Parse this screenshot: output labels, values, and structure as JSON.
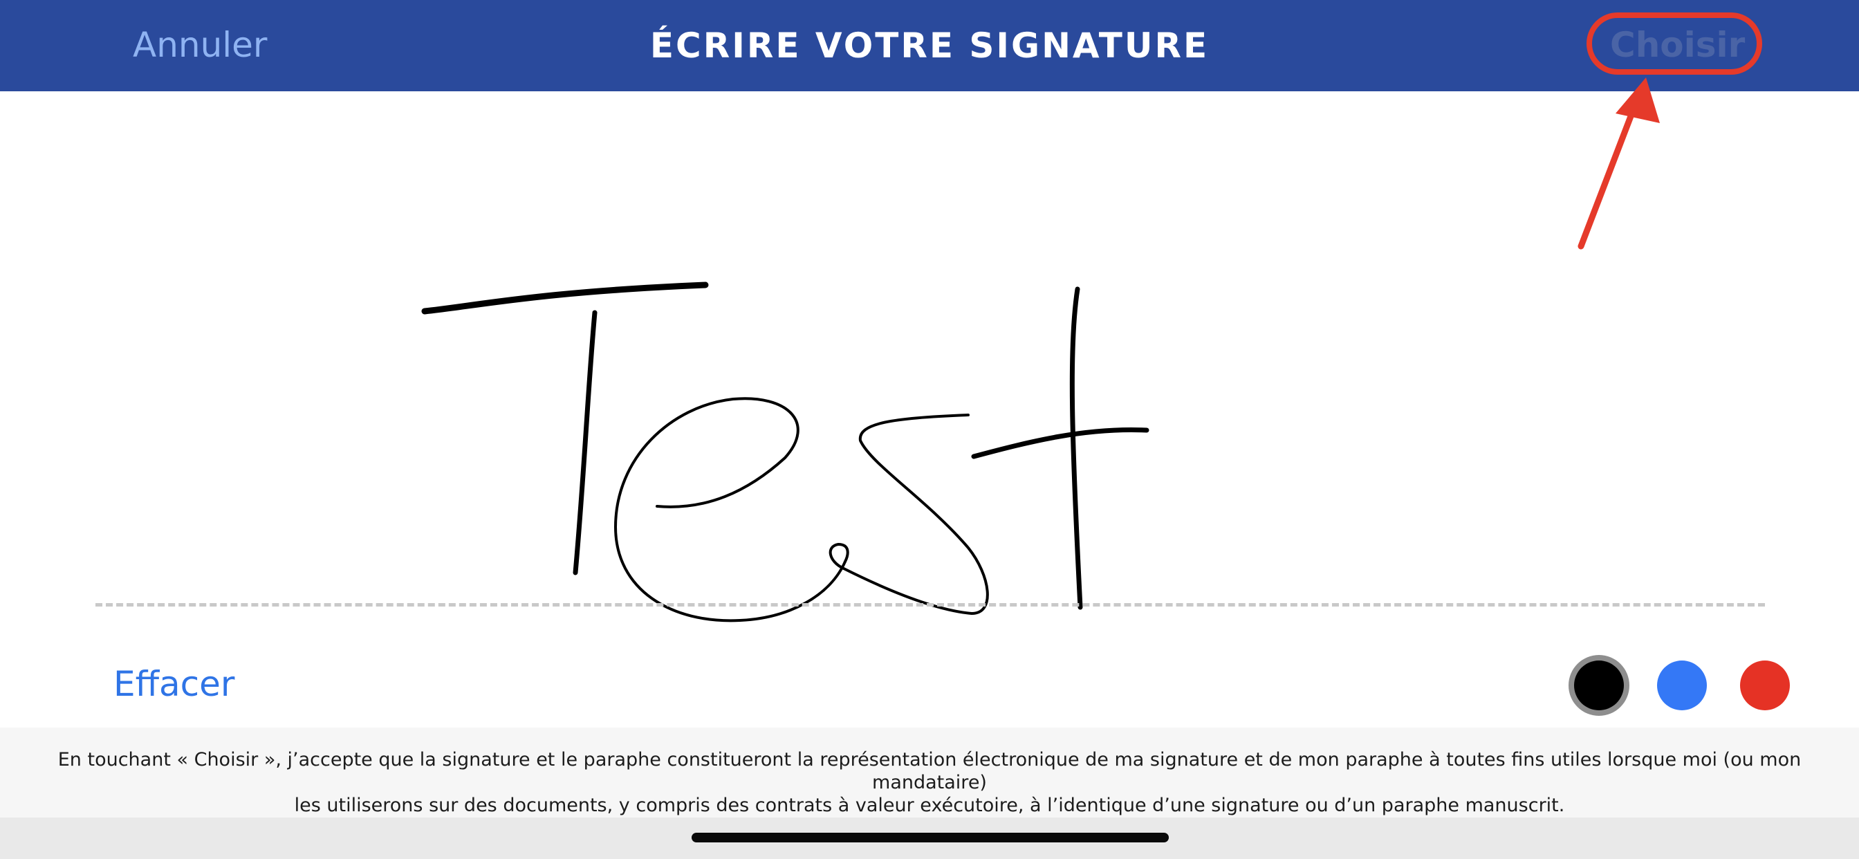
{
  "header": {
    "cancel_label": "Annuler",
    "title": "ÉCRIRE VOTRE SIGNATURE",
    "choose_label": "Choisir"
  },
  "signature": {
    "ink_color": "#000000",
    "written_word": "Test"
  },
  "toolbar": {
    "clear_label": "Effacer",
    "colors": [
      "#000000",
      "#3478f6",
      "#e53225"
    ],
    "selected_color": "#000000"
  },
  "legal": {
    "line1": "En touchant « Choisir », j’accepte que la signature et le paraphe constitueront la représentation électronique de ma signature et de mon paraphe à toutes fins utiles lorsque moi (ou mon mandataire)",
    "line2": "les utiliserons sur des documents, y compris des contrats à valeur exécutoire, à l’identique d’une signature ou d’un paraphe manuscrit."
  },
  "annotation": {
    "color": "#e53a2a"
  }
}
